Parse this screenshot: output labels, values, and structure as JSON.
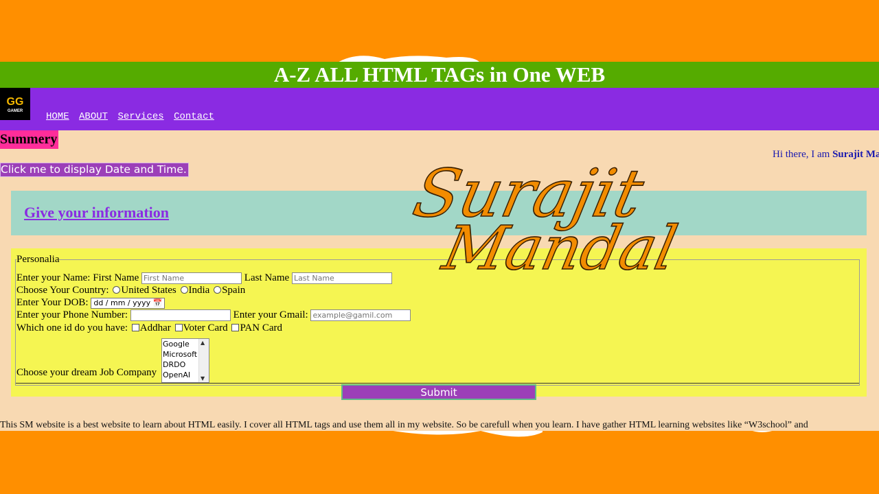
{
  "site": {
    "title": "A-Z ALL HTML TAGs in One WEB"
  },
  "logo": {
    "line1": "GG",
    "line2": "GAMER"
  },
  "nav": {
    "items": [
      {
        "label": "HOME"
      },
      {
        "label": "ABOUT"
      },
      {
        "label": "Services"
      },
      {
        "label": "Contact"
      }
    ]
  },
  "summary": {
    "heading": "Summery"
  },
  "greeting": {
    "prefix": "Hi there, I am ",
    "name": "Surajit Ma"
  },
  "date_button": {
    "label": "Click me to display Date and Time."
  },
  "info": {
    "heading": "Give your information"
  },
  "form": {
    "legend": "Personalia",
    "name_label": "Enter your Name: First Name",
    "first_placeholder": "First Name",
    "last_label": "Last Name",
    "last_placeholder": "Last Name",
    "country_label": "Choose Your Country:",
    "countries": [
      "United States",
      "India",
      "Spain"
    ],
    "dob_label": "Enter Your DOB:",
    "dob_value": "dd / mm / yyyy",
    "phone_label": "Enter your Phone Number:",
    "gmail_label": "Enter your Gmail:",
    "gmail_placeholder": "example@gamil.com",
    "id_label": "Which one id do you have:",
    "ids": [
      "Addhar",
      "Voter Card",
      "PAN Card"
    ],
    "job_label": "Choose your dream Job Company",
    "companies": [
      "Google",
      "Microsoft",
      "DRDO",
      "OpenAI"
    ],
    "submit_label": "Submit"
  },
  "footer": {
    "text": "This SM website is a best website to learn about HTML easily. I cover all HTML tags and use them all in my website. So be carefull when you learn. I have gather HTML learning websites like “W3school” and"
  },
  "watermark": {
    "line1": "Surajit",
    "line2": "Mandal"
  },
  "colors": {
    "frame": "#ff8f00",
    "title_bar": "#55ab00",
    "nav_bar": "#8a2be2",
    "page_bg": "#f8d9b2",
    "form_bg": "#f5f552",
    "info_bg": "#a2d7c7"
  }
}
